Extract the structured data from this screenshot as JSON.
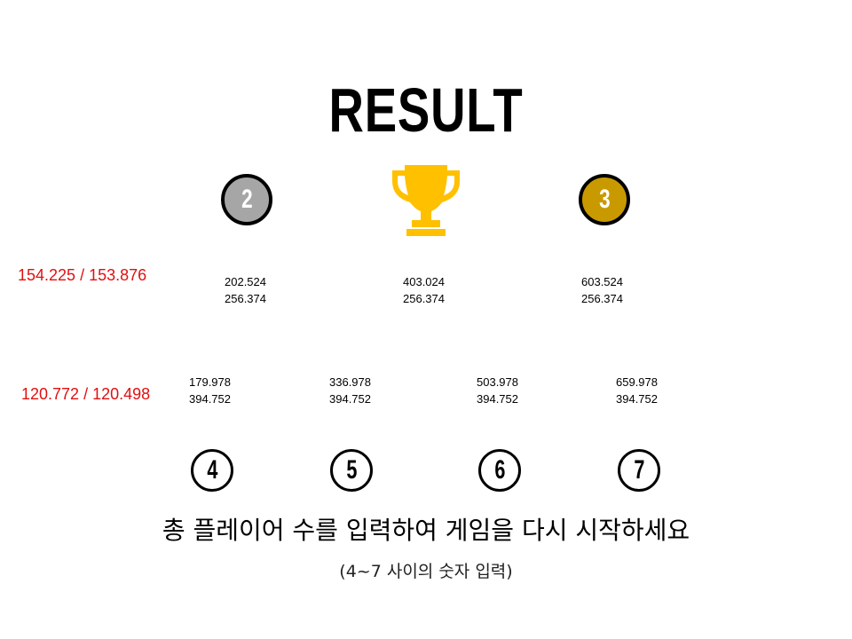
{
  "title": "RESULT",
  "podium": {
    "second": {
      "label": "2",
      "color": "#a6a6a6"
    },
    "first": {
      "icon": "trophy-icon",
      "color": "#ffc000"
    },
    "third": {
      "label": "3",
      "color": "#c99a00"
    }
  },
  "top_coords": [
    {
      "x": "202.524",
      "y": "256.374"
    },
    {
      "x": "403.024",
      "y": "256.374"
    },
    {
      "x": "603.524",
      "y": "256.374"
    }
  ],
  "bottom_coords": [
    {
      "x": "179.978",
      "y": "394.752"
    },
    {
      "x": "336.978",
      "y": "394.752"
    },
    {
      "x": "503.978",
      "y": "394.752"
    },
    {
      "x": "659.978",
      "y": "394.752"
    }
  ],
  "red_labels": {
    "top": "154.225 / 153.876",
    "bottom": "120.772 / 120.498"
  },
  "player_counts": [
    "4",
    "5",
    "6",
    "7"
  ],
  "instruction": "총 플레이어 수를 입력하여 게임을 다시 시작하세요",
  "hint": "(4~7 사이의 숫자 입력)"
}
